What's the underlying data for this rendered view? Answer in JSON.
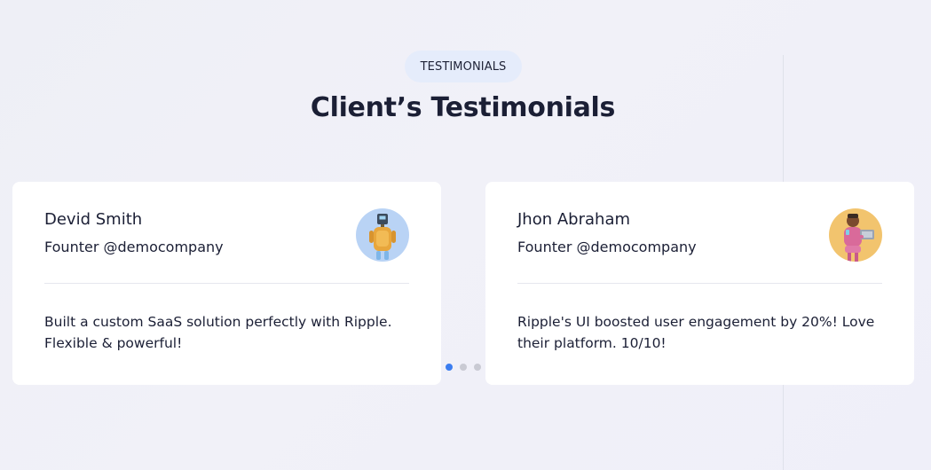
{
  "section": {
    "badge": "TESTIMONIALS",
    "title": "Client’s Testimonials"
  },
  "testimonials": [
    {
      "name": "Devid Smith",
      "role": "Founter @democompany",
      "quote": "Built a custom SaaS solution perfectly with Ripple. Flexible & powerful!",
      "avatar_icon": "robot-avatar-icon",
      "avatar_bg": "#b9d3f5"
    },
    {
      "name": "Jhon Abraham",
      "role": "Founter @democompany",
      "quote": "Ripple's UI boosted user engagement by 20%! Love their platform. 10/10!",
      "avatar_icon": "person-laptop-avatar-icon",
      "avatar_bg": "#f2c46e"
    }
  ],
  "carousel": {
    "slides": 3,
    "active_index": 0
  },
  "colors": {
    "accent": "#3b7df0",
    "badge_bg": "#e5ecfb",
    "text": "#1b1f35"
  }
}
